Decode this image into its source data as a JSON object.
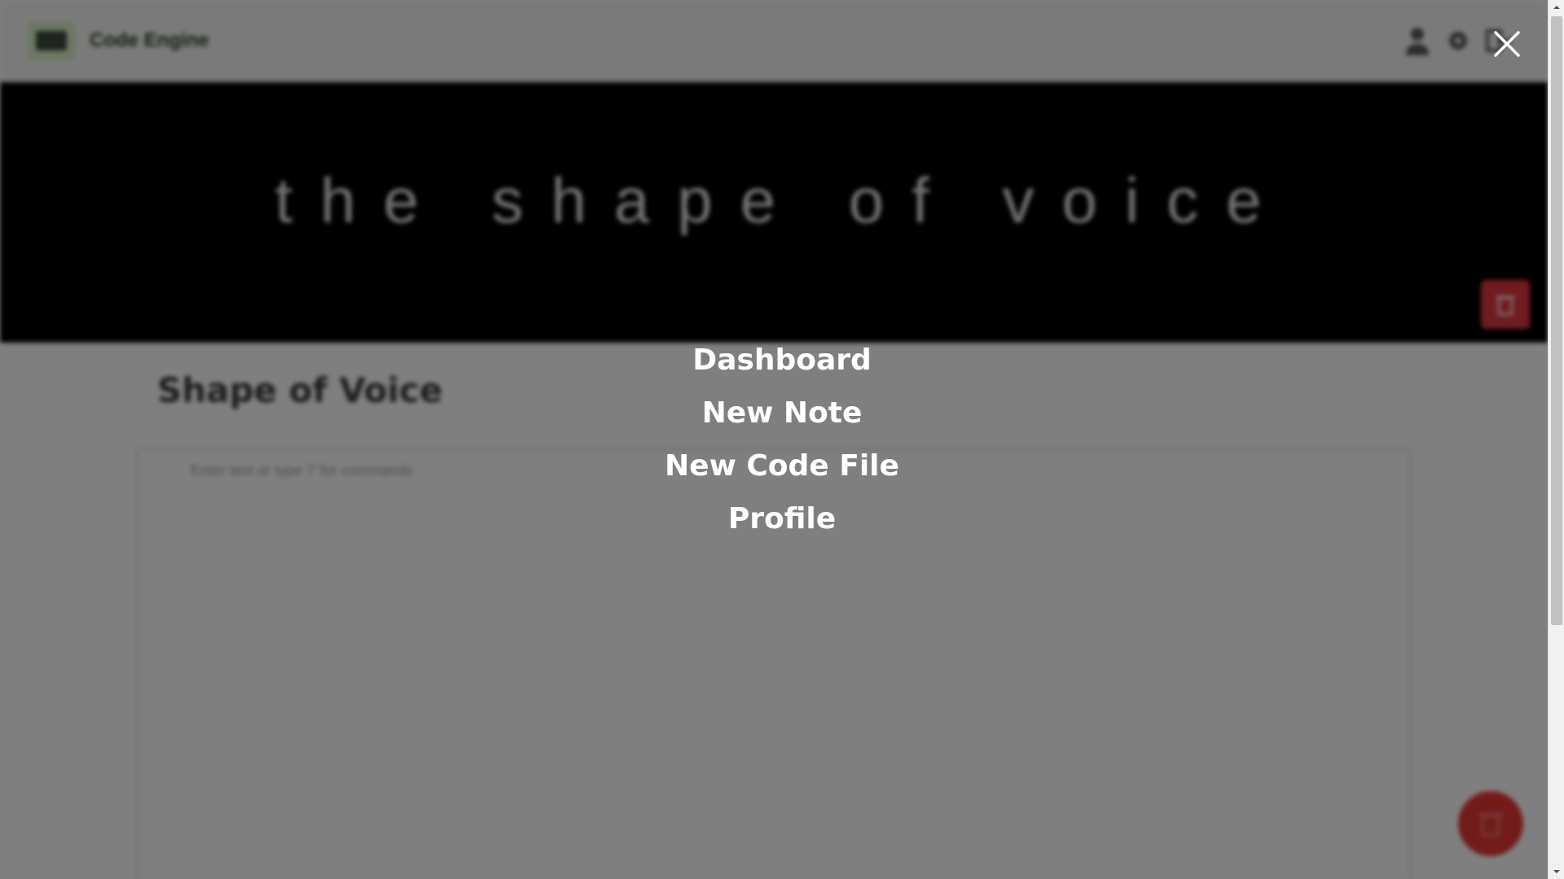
{
  "app": {
    "title": "Code Engine"
  },
  "banner": {
    "text": "the shape of voice"
  },
  "note": {
    "title": "Shape of Voice",
    "editor_placeholder": "Enter text or type '/' for commands"
  },
  "menu": {
    "items": [
      {
        "label": "Dashboard"
      },
      {
        "label": "New Note"
      },
      {
        "label": "New Code File"
      },
      {
        "label": "Profile"
      }
    ]
  },
  "icons": {
    "logo": "code-editor-logo",
    "user": "user-icon",
    "settings": "gear-icon",
    "logout": "exit-icon",
    "close": "close-icon",
    "delete": "trash-icon"
  },
  "colors": {
    "overlay": "#000000",
    "danger": "#e53935",
    "accent": "#d7f0c7"
  }
}
